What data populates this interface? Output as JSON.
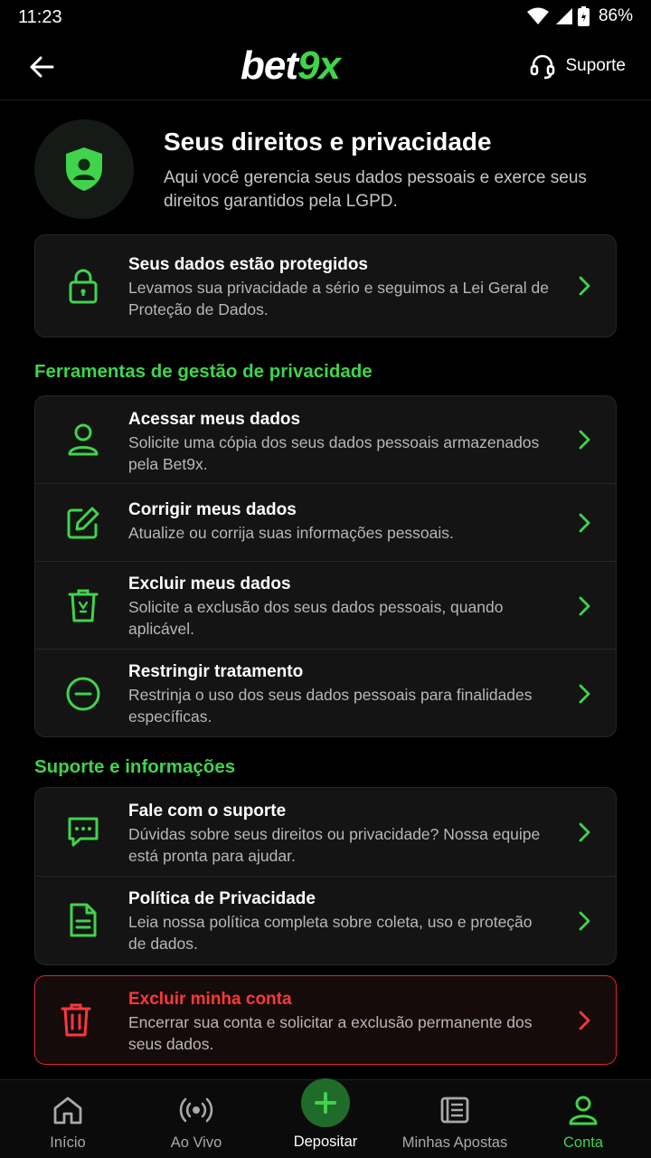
{
  "status_bar": {
    "time": "11:23",
    "battery": "86%"
  },
  "header": {
    "logo_main": "bet",
    "logo_accent": "9x",
    "support_label": "Suporte"
  },
  "intro": {
    "title": "Seus direitos e privacidade",
    "description": "Aqui você gerencia seus dados pessoais e exerce seus direitos garantidos pela LGPD."
  },
  "protected_card": {
    "title": "Seus dados estão protegidos",
    "description": "Levamos sua privacidade a sério e seguimos a Lei Geral de Proteção de Dados."
  },
  "tools_section": {
    "title": "Ferramentas de gestão de privacidade",
    "items": [
      {
        "icon": "user-icon",
        "title": "Acessar meus dados",
        "description": "Solicite uma cópia dos seus dados pessoais armazenados pela Bet9x."
      },
      {
        "icon": "edit-icon",
        "title": "Corrigir meus dados",
        "description": "Atualize ou corrija suas informações pessoais."
      },
      {
        "icon": "trash-icon",
        "title": "Excluir meus dados",
        "description": "Solicite a exclusão dos seus dados pessoais, quando aplicável."
      },
      {
        "icon": "minus-circle-icon",
        "title": "Restringir tratamento",
        "description": "Restrinja o uso dos seus dados pessoais para finalidades específicas."
      }
    ]
  },
  "support_section": {
    "title": "Suporte e informações",
    "items": [
      {
        "icon": "chat-icon",
        "title": "Fale com o suporte",
        "description": "Dúvidas sobre seus direitos ou privacidade? Nossa equipe está pronta para ajudar."
      },
      {
        "icon": "document-icon",
        "title": "Política de Privacidade",
        "description": "Leia nossa política completa sobre coleta, uso e proteção de dados."
      }
    ]
  },
  "delete_account": {
    "title": "Excluir minha conta",
    "description": "Encerrar sua conta e solicitar a exclusão permanente dos seus dados."
  },
  "bottom_nav": {
    "items": [
      {
        "icon": "home-icon",
        "label": "Início"
      },
      {
        "icon": "live-icon",
        "label": "Ao Vivo"
      },
      {
        "icon": "plus-icon",
        "label": "Depositar"
      },
      {
        "icon": "bets-list-icon",
        "label": "Minhas Apostas"
      },
      {
        "icon": "account-icon",
        "label": "Conta",
        "active": true
      }
    ]
  },
  "colors": {
    "accent": "#3fd44b",
    "danger": "#ff3838",
    "background": "#000000",
    "card": "#141414"
  }
}
